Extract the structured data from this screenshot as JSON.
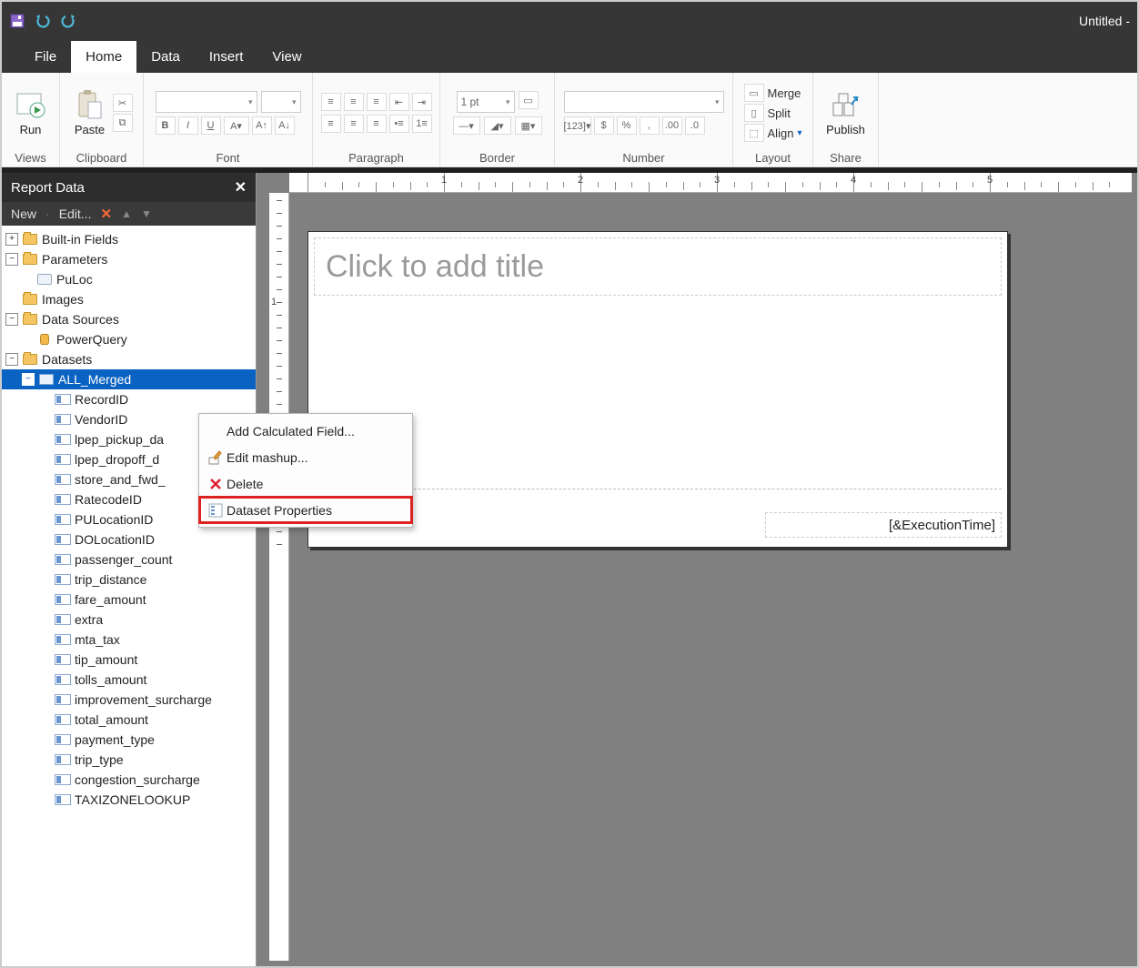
{
  "title": "Untitled -",
  "tabs": {
    "file": "File",
    "home": "Home",
    "data": "Data",
    "insert": "Insert",
    "view": "View"
  },
  "ribbon": {
    "views": "Views",
    "clipboard": "Clipboard",
    "font": "Font",
    "paragraph": "Paragraph",
    "border": "Border",
    "number": "Number",
    "layout": "Layout",
    "share": "Share",
    "run": "Run",
    "paste": "Paste",
    "pt": "1 pt",
    "merge": "Merge",
    "split": "Split",
    "align": "Align",
    "publish": "Publish"
  },
  "panel": {
    "title": "Report Data",
    "new": "New",
    "edit": "Edit...",
    "nodes": {
      "builtins": "Built-in Fields",
      "params": "Parameters",
      "puloc": "PuLoc",
      "images": "Images",
      "datasources": "Data Sources",
      "powerquery": "PowerQuery",
      "datasets": "Datasets",
      "allmerged": "ALL_Merged"
    },
    "fields": [
      "RecordID",
      "VendorID",
      "lpep_pickup_da",
      "lpep_dropoff_d",
      "store_and_fwd_",
      "RatecodeID",
      "PULocationID",
      "DOLocationID",
      "passenger_count",
      "trip_distance",
      "fare_amount",
      "extra",
      "mta_tax",
      "tip_amount",
      "tolls_amount",
      "improvement_surcharge",
      "total_amount",
      "payment_type",
      "trip_type",
      "congestion_surcharge",
      "TAXIZONELOOKUP"
    ]
  },
  "canvas": {
    "title_placeholder": "Click to add title",
    "footer": "[&ExecutionTime]"
  },
  "menu": {
    "calc": "Add Calculated Field...",
    "mashup": "Edit mashup...",
    "delete": "Delete",
    "props": "Dataset Properties"
  }
}
